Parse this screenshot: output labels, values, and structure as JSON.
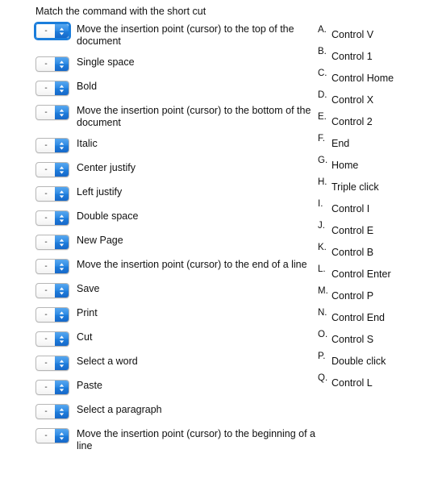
{
  "header": {
    "instruction": "Match the command with the short cut"
  },
  "select": {
    "value": "-",
    "placeholder": "-",
    "arrow_icon": "up-down-chevron-icon",
    "focused_index": 0,
    "colors": {
      "accent_blue": "#1f7ddb",
      "focus_ring": "#1a7ddb",
      "border_gray": "#b6b6b6",
      "text": "#111111",
      "background": "#ffffff"
    }
  },
  "commands": [
    {
      "label": "Move the insertion point (cursor) to the top of the document"
    },
    {
      "label": "Single space"
    },
    {
      "label": "Bold"
    },
    {
      "label": "Move the insertion point (cursor) to the bottom of the document"
    },
    {
      "label": "Italic"
    },
    {
      "label": "Center justify"
    },
    {
      "label": "Left justify"
    },
    {
      "label": "Double space"
    },
    {
      "label": "New Page"
    },
    {
      "label": "Move the insertion point (cursor) to the end of a line"
    },
    {
      "label": "Save"
    },
    {
      "label": "Print"
    },
    {
      "label": "Cut"
    },
    {
      "label": "Select a word"
    },
    {
      "label": "Paste"
    },
    {
      "label": "Select a paragraph"
    },
    {
      "label": "Move the insertion point (cursor) to the beginning of a line"
    }
  ],
  "options": [
    {
      "letter": "A.",
      "text": "Control V"
    },
    {
      "letter": "B.",
      "text": "Control 1"
    },
    {
      "letter": "C.",
      "text": "Control Home"
    },
    {
      "letter": "D.",
      "text": "Control X"
    },
    {
      "letter": "E.",
      "text": "Control 2"
    },
    {
      "letter": "F.",
      "text": "End"
    },
    {
      "letter": "G.",
      "text": "Home"
    },
    {
      "letter": "H.",
      "text": "Triple click"
    },
    {
      "letter": "I.",
      "text": "Control I"
    },
    {
      "letter": "J.",
      "text": "Control E"
    },
    {
      "letter": "K.",
      "text": "Control B"
    },
    {
      "letter": "L.",
      "text": "Control Enter"
    },
    {
      "letter": "M.",
      "text": "Control P"
    },
    {
      "letter": "N.",
      "text": "Control End"
    },
    {
      "letter": "O.",
      "text": "Control S"
    },
    {
      "letter": "P.",
      "text": "Double click"
    },
    {
      "letter": "Q.",
      "text": "Control L"
    }
  ]
}
